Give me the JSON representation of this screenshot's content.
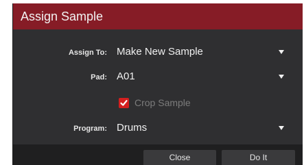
{
  "dialog": {
    "title": "Assign Sample",
    "fields": [
      {
        "label": "Assign To:",
        "value": "Make New Sample"
      },
      {
        "label": "Pad:",
        "value": "A01"
      },
      {
        "label": "Program:",
        "value": "Drums"
      }
    ],
    "crop_sample": {
      "label": "Crop Sample",
      "checked": true
    },
    "buttons": {
      "close": "Close",
      "do_it": "Do It"
    }
  },
  "icons": {
    "dropdown": "caret-down-icon",
    "checkmark": "checkmark-icon"
  },
  "colors": {
    "titlebar": "#861c26",
    "dialog_bg": "#2f2f31",
    "footer_bg": "#1f1f20",
    "checkbox": "#d41f1f",
    "disabled_text": "#7c7c7c"
  }
}
